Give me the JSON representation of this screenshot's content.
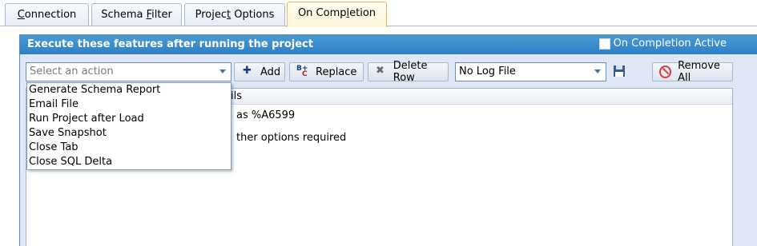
{
  "tabs": [
    {
      "label": "Connection",
      "underline_char": "C"
    },
    {
      "label": "Schema Filter",
      "underline_char": "F"
    },
    {
      "label": "Project Options",
      "underline_char": "t"
    },
    {
      "label": "On Completion",
      "underline_char": "l",
      "active": true
    }
  ],
  "panel": {
    "title": "Execute these features after running the project",
    "on_completion_active_label": "On Completion Active",
    "on_completion_active_checked": false
  },
  "toolbar": {
    "action_placeholder": "Select an action",
    "add_label": "Add",
    "replace_label": "Replace",
    "delete_row_label": "Delete Row",
    "log_file_value": "No Log File",
    "remove_all_label": "Remove All"
  },
  "grid": {
    "column_header_partial": "ils",
    "rows_partial": [
      "as %A6599",
      "ther options required"
    ]
  },
  "action_options": [
    "Generate Schema Report",
    "Email File",
    "Run Project after Load",
    "Save Snapshot",
    "Close Tab",
    "Close SQL Delta"
  ],
  "colors": {
    "header_blue": "#2f80c4",
    "active_tab_border": "#e6b84a",
    "panel_bg": "#dfe8f4"
  }
}
